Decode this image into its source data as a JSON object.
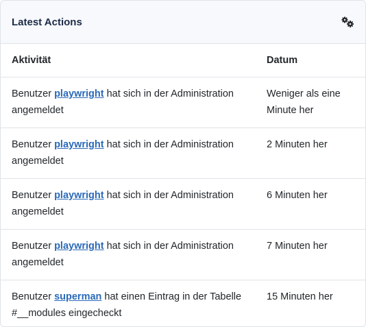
{
  "header": {
    "title": "Latest Actions",
    "options_icon": "gears-icon"
  },
  "table": {
    "columns": [
      "Aktivität",
      "Datum"
    ],
    "rows": [
      {
        "prefix": "Benutzer ",
        "user": "playwright",
        "suffix": " hat sich in der Administration angemeldet",
        "date": "Weniger als eine Minute her"
      },
      {
        "prefix": "Benutzer ",
        "user": "playwright",
        "suffix": " hat sich in der Administration angemeldet",
        "date": "2 Minuten her"
      },
      {
        "prefix": "Benutzer ",
        "user": "playwright",
        "suffix": " hat sich in der Administration angemeldet",
        "date": "6 Minuten her"
      },
      {
        "prefix": "Benutzer ",
        "user": "playwright",
        "suffix": " hat sich in der Administration angemeldet",
        "date": "7 Minuten her"
      },
      {
        "prefix": "Benutzer ",
        "user": "superman",
        "suffix": " hat einen Eintrag in der Tabelle #__modules eingecheckt",
        "date": "15 Minuten her"
      }
    ]
  }
}
